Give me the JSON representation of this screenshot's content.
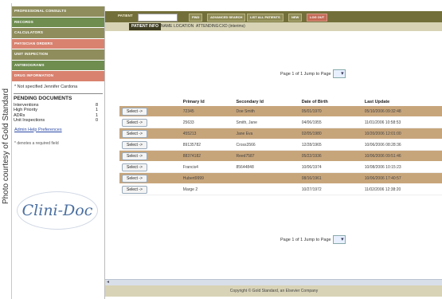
{
  "credit": "Photo courtesy of Gold Standard",
  "sidebar": {
    "menu": [
      {
        "label": "PROFESSIONAL CONSULTS",
        "color": "#8f8d5c"
      },
      {
        "label": "RECORDS",
        "color": "#6e8d4f"
      },
      {
        "label": "CALCULATORS",
        "color": "#8f8d5c"
      },
      {
        "label": "PHYSICIAN ORDERS",
        "color": "#d9826f"
      },
      {
        "label": "UNIT INSPECTION",
        "color": "#8f8d5c"
      },
      {
        "label": "ANTIBIOGRAMS",
        "color": "#6e8d4f"
      },
      {
        "label": "DRUG INFORMATION",
        "color": "#d9826f"
      }
    ],
    "note": "* Not specified   Jennifer Cardona",
    "pending_title": "PENDING DOCUMENTS",
    "pending": [
      {
        "label": "Interventions",
        "value": "8"
      },
      {
        "label": "High Priority",
        "value": "1"
      },
      {
        "label": "ADRs",
        "value": "1"
      },
      {
        "label": "Unit Inspections",
        "value": "0"
      }
    ],
    "links": "Admin Help  Preferences",
    "required_note": "* denotes a required field",
    "logo": "Clini-Doc"
  },
  "topbar": {
    "patient_label": "PATIENT",
    "buttons": [
      "FIND",
      "ADVANCED SEARCH",
      "LIST ALL PATIENTS",
      "NEW"
    ],
    "logout": "LOG OUT"
  },
  "tabs": {
    "active": "PATIENT INFO",
    "others": [
      "NAME",
      "LOCATION",
      "ATTENDING",
      "CXD (interims)"
    ]
  },
  "pager": {
    "text": "Page 1 of 1  Jump to Page"
  },
  "table": {
    "headers": [
      "",
      "Primary Id",
      "Secondary Id",
      "Date of Birth",
      "Last Update"
    ],
    "rows": [
      {
        "select": "Select ->",
        "primary": "72345",
        "secondary": "Doe Smith",
        "dob": "05/01/1970",
        "updated": "05/10/2006 09:32:48"
      },
      {
        "select": "Select ->",
        "primary": "25633",
        "secondary": "Smith, Jane",
        "dob": "04/06/1955",
        "updated": "11/01/2006 10:58:53"
      },
      {
        "select": "Select ->",
        "primary": "455213",
        "secondary": "Jane Eva",
        "dob": "02/05/1980",
        "updated": "10/20/2006 12:01:00"
      },
      {
        "select": "Select ->",
        "primary": "89135782",
        "secondary": "Cross3566",
        "dob": "12/28/1965",
        "updated": "10/06/2006 08:28:36"
      },
      {
        "select": "Select ->",
        "primary": "88374182",
        "secondary": "Reed7587",
        "dob": "05/22/1936",
        "updated": "10/06/2006 09:51:46"
      },
      {
        "select": "Select ->",
        "primary": "Francis4",
        "secondary": "85644848",
        "dob": "10/06/1974",
        "updated": "10/08/2006 10:15:23"
      },
      {
        "select": "Select ->",
        "primary": "Hubert9999",
        "secondary": "",
        "dob": "08/16/1961",
        "updated": "10/06/2006 17:40:57"
      },
      {
        "select": "Select ->",
        "primary": "Marge 2",
        "secondary": "",
        "dob": "10/27/1972",
        "updated": "11/02/2006 12:38:20"
      }
    ]
  },
  "footer": "Copyright © Gold Standard, an Elsevier Company"
}
